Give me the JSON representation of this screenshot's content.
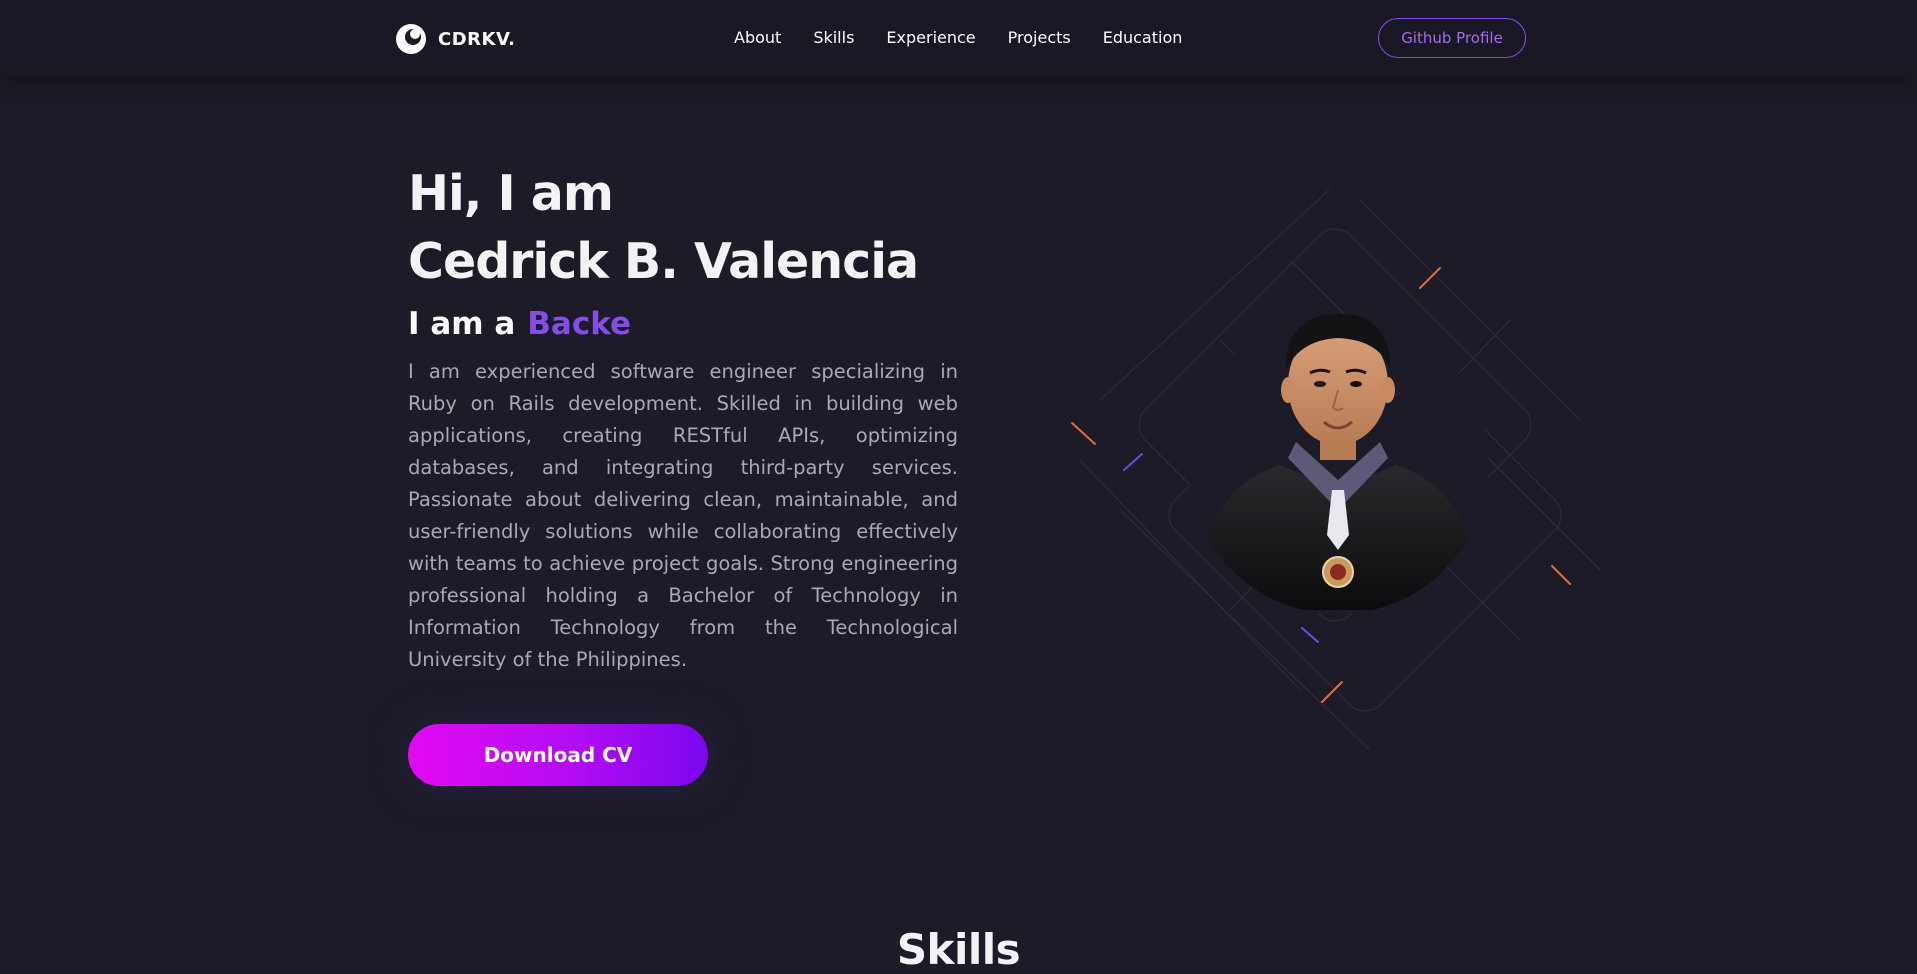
{
  "nav": {
    "brand": "CDRKV.",
    "links": [
      "About",
      "Skills",
      "Experience",
      "Projects",
      "Education"
    ],
    "github_label": "Github Profile"
  },
  "hero": {
    "greeting": "Hi, I am",
    "name": "Cedrick B. Valencia",
    "role_prefix": "I am a",
    "role_value": "Backe",
    "description": "I am experienced software engineer specializing in Ruby on Rails development. Skilled in building web applications, creating RESTful APIs, optimizing databases, and integrating third-party services. Passionate about delivering clean, maintainable, and user-friendly solutions while collaborating effectively with teams to achieve project goals. Strong engineering professional holding a Bachelor of Technology in Information Technology from the Technological University of the Philippines.",
    "cv_button": "Download CV"
  },
  "sections": {
    "skills_title": "Skills"
  },
  "icons": {
    "logo": "circle-logo-icon"
  },
  "colors": {
    "background": "#1c1b27",
    "accent": "#854ce6",
    "cv_gradient_start": "#e20af2",
    "cv_gradient_end": "#7b07ef"
  }
}
